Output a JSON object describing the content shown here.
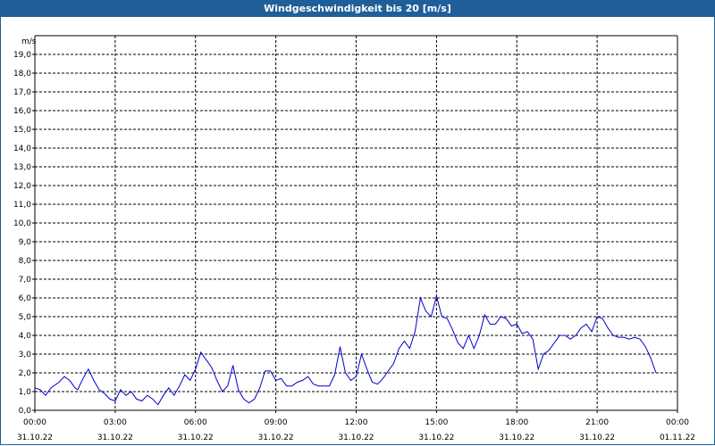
{
  "window": {
    "title": "Windgeschwindigkeit bis 20 [m/s]"
  },
  "colors": {
    "title_bar": "#1f5f99",
    "series": "#0000cc",
    "grid": "#000000"
  },
  "chart_data": {
    "type": "line",
    "title": "Windgeschwindigkeit bis 20 [m/s]",
    "y_unit": "m/s",
    "ylim": [
      0,
      20
    ],
    "y_ticks": [
      "0,0",
      "1,0",
      "2,0",
      "3,0",
      "4,0",
      "5,0",
      "6,0",
      "7,0",
      "8,0",
      "9,0",
      "10,0",
      "11,0",
      "12,0",
      "13,0",
      "14,0",
      "15,0",
      "16,0",
      "17,0",
      "18,0",
      "19,0"
    ],
    "x_ticks": [
      {
        "time": "00:00",
        "date": "31.10.22"
      },
      {
        "time": "03:00",
        "date": "31.10.22"
      },
      {
        "time": "06:00",
        "date": "31.10.22"
      },
      {
        "time": "09:00",
        "date": "31.10.22"
      },
      {
        "time": "12:00",
        "date": "31.10.22"
      },
      {
        "time": "15:00",
        "date": "31.10.22"
      },
      {
        "time": "18:00",
        "date": "31.10.22"
      },
      {
        "time": "21:00",
        "date": "31.10.22"
      },
      {
        "time": "00:00",
        "date": "01.11.22"
      }
    ],
    "grid": true,
    "series": [
      {
        "hours": [
          0,
          0.2,
          0.4,
          0.6,
          0.9,
          1.1,
          1.3,
          1.5,
          1.6,
          1.8,
          2.0,
          2.2,
          2.4,
          2.6,
          2.8,
          3.0,
          3.2,
          3.4,
          3.6,
          3.8,
          4.0,
          4.2,
          4.4,
          4.6,
          4.8,
          5.0,
          5.2,
          5.4,
          5.6,
          5.8,
          6.0,
          6.2,
          6.4,
          6.6,
          6.8,
          7.0,
          7.2,
          7.4,
          7.6,
          7.8,
          8.0,
          8.2,
          8.4,
          8.6,
          8.8,
          9.0,
          9.2,
          9.4,
          9.6,
          9.8,
          10.0,
          10.2,
          10.4,
          10.6,
          10.8,
          11.0,
          11.2,
          11.4,
          11.6,
          11.8,
          12.0,
          12.2,
          12.4,
          12.6,
          12.8,
          13.0,
          13.2,
          13.4,
          13.6,
          13.8,
          14.0,
          14.2,
          14.4,
          14.6,
          14.8,
          15.0,
          15.2,
          15.4,
          15.6,
          15.8,
          16.0,
          16.2,
          16.4,
          16.6,
          16.8,
          17.0,
          17.2,
          17.4,
          17.6,
          17.8,
          18.0,
          18.2,
          18.4,
          18.6,
          18.8,
          19.0,
          19.2,
          19.4,
          19.6,
          19.8,
          20.0,
          20.2,
          20.4,
          20.6,
          20.8,
          21.0,
          21.2,
          21.4,
          21.6,
          21.8,
          22.0,
          22.2,
          22.4,
          22.6,
          22.8,
          23.0,
          23.2,
          23.4,
          23.6,
          23.8,
          24.0
        ],
        "values": [
          1.2,
          1.1,
          0.8,
          1.2,
          1.5,
          1.8,
          1.6,
          1.2,
          1.1,
          1.7,
          2.2,
          1.6,
          1.1,
          0.9,
          0.6,
          0.5,
          1.1,
          0.8,
          1.0,
          0.6,
          0.5,
          0.8,
          0.6,
          0.3,
          0.8,
          1.2,
          0.8,
          1.3,
          1.9,
          1.6,
          2.2,
          3.1,
          2.7,
          2.3,
          1.6,
          1.0,
          1.3,
          2.4,
          1.1,
          0.6,
          0.4,
          0.6,
          1.2,
          2.1,
          2.1,
          1.6,
          1.7,
          1.3,
          1.3,
          1.5,
          1.6,
          1.8,
          1.4,
          1.3,
          1.3,
          1.3,
          1.9,
          3.4,
          2.0,
          1.6,
          1.8,
          3.0,
          2.2,
          1.5,
          1.4,
          1.7,
          2.1,
          2.5,
          3.3,
          3.7,
          3.3,
          4.2,
          6.0,
          5.3,
          5.0,
          6.1,
          5.0,
          4.9,
          4.3,
          3.6,
          3.3,
          4.0,
          3.3,
          4.0,
          5.1,
          4.6,
          4.6,
          5.0,
          4.9,
          4.5,
          4.6,
          4.1,
          4.2,
          3.8,
          2.2,
          3.0,
          3.2,
          3.6,
          4.0,
          4.0,
          3.8,
          4.0,
          4.4,
          4.6,
          4.2,
          5.0,
          4.9,
          4.4,
          4.0,
          3.9,
          3.9,
          3.8,
          3.9,
          3.8,
          3.4,
          2.8,
          2.0
        ]
      }
    ]
  }
}
